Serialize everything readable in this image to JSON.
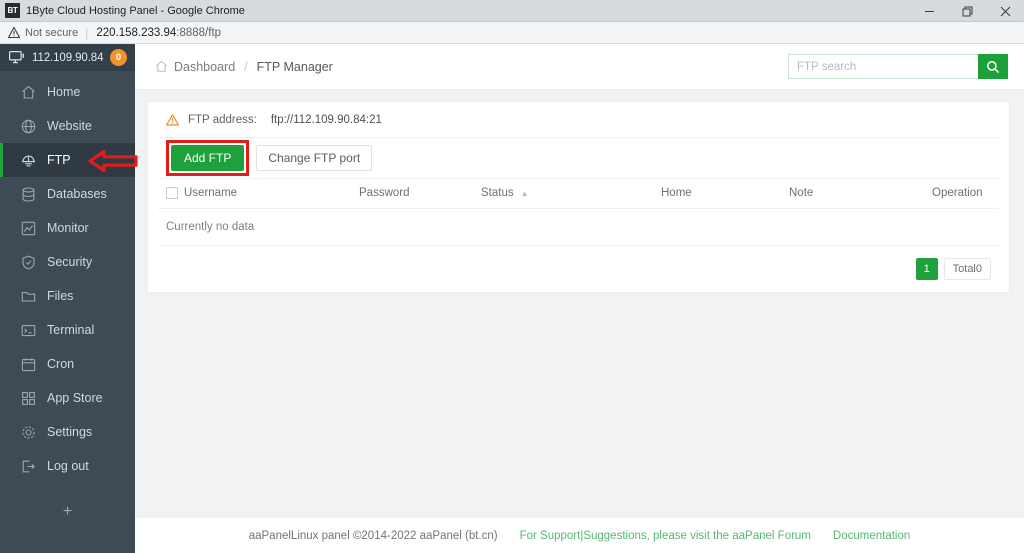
{
  "browser": {
    "tab_title": "1Byte Cloud Hosting Panel - Google Chrome",
    "favicon_text": "BT",
    "security_label": "Not secure",
    "url_host": "220.158.233.94",
    "url_path": ":8888/ftp",
    "window_controls": {
      "minimize": "minimize-icon",
      "maximize": "restore-icon",
      "close": "close-icon"
    }
  },
  "sidebar": {
    "server_ip": "112.109.90.84",
    "badge_count": "0",
    "monitor_icon": "monitor-icon",
    "add_label": "+",
    "items": [
      {
        "label": "Home",
        "icon": "home-icon",
        "active": false
      },
      {
        "label": "Website",
        "icon": "globe-icon",
        "active": false
      },
      {
        "label": "FTP",
        "icon": "ftp-icon",
        "active": true
      },
      {
        "label": "Databases",
        "icon": "database-icon",
        "active": false
      },
      {
        "label": "Monitor",
        "icon": "chart-icon",
        "active": false
      },
      {
        "label": "Security",
        "icon": "shield-icon",
        "active": false
      },
      {
        "label": "Files",
        "icon": "folder-icon",
        "active": false
      },
      {
        "label": "Terminal",
        "icon": "terminal-icon",
        "active": false
      },
      {
        "label": "Cron",
        "icon": "calendar-icon",
        "active": false
      },
      {
        "label": "App Store",
        "icon": "grid-icon",
        "active": false
      },
      {
        "label": "Settings",
        "icon": "gear-icon",
        "active": false
      },
      {
        "label": "Log out",
        "icon": "logout-icon",
        "active": false
      }
    ]
  },
  "header": {
    "breadcrumb": {
      "home_icon": "home-icon",
      "root": "Dashboard",
      "separator": "/",
      "current": "FTP Manager"
    },
    "search": {
      "placeholder": "FTP search",
      "value": "",
      "button_icon": "search-icon"
    }
  },
  "notice": {
    "warning_icon": "warning-triangle-icon",
    "label": "FTP address:",
    "value": "ftp://112.109.90.84:21"
  },
  "toolbar": {
    "add_ftp_label": "Add FTP",
    "change_port_label": "Change FTP port",
    "highlight_color": "#e41b1b"
  },
  "table": {
    "columns": [
      "Username",
      "Password",
      "Status",
      "Home",
      "Note",
      "Operation"
    ],
    "sort_column": "Status",
    "sort_caret": "▲",
    "rows": [],
    "empty_text": "Currently no data"
  },
  "pagination": {
    "current_page": "1",
    "total_label": "Total0"
  },
  "footer": {
    "copyright": "aaPanelLinux panel ©2014-2022 aaPanel (bt.cn)",
    "support_link": "For Support|Suggestions, please visit the aaPanel Forum",
    "docs_link": "Documentation"
  },
  "annotation": {
    "arrow": "red-left-arrow-pointer",
    "arrow_color": "#e41b1b"
  },
  "colors": {
    "accent_green": "#1ea13b",
    "sidebar_bg": "#3e4a54",
    "badge_orange": "#f0942b",
    "highlight_red": "#e41b1b"
  }
}
